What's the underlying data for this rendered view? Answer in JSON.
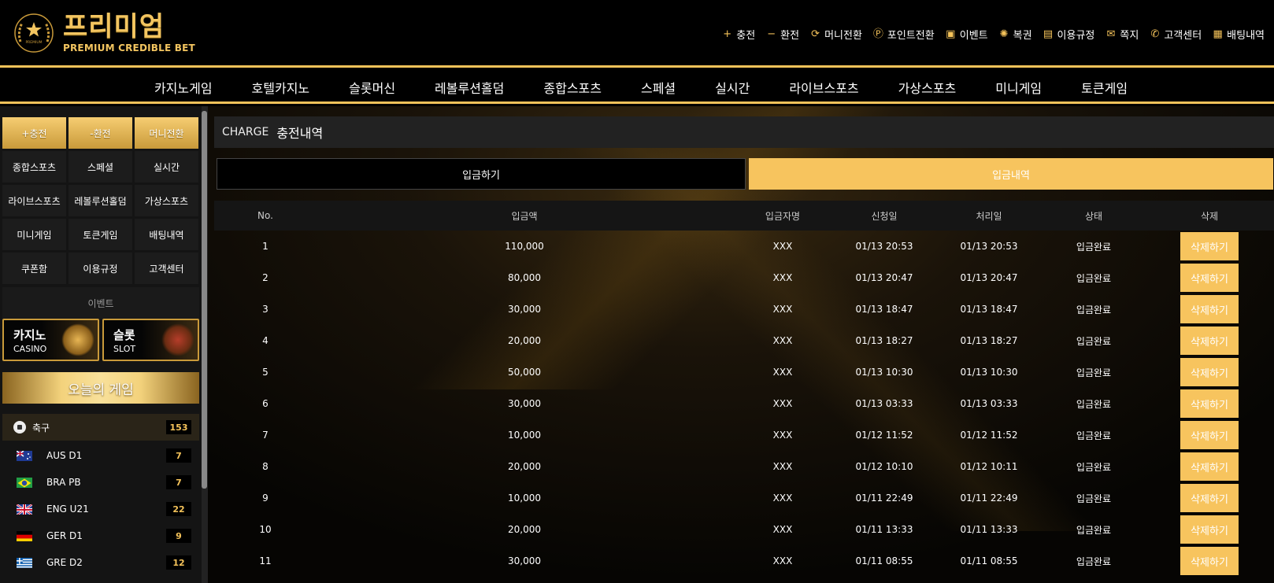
{
  "logo": {
    "title": "프리미엄",
    "subtitle": "PREMIUM CREDIBLE BET",
    "emblem_text": "PREMIUM"
  },
  "top_links": [
    {
      "icon": "plus-icon",
      "glyph": "+",
      "label": "충전"
    },
    {
      "icon": "minus-icon",
      "glyph": "−",
      "label": "환전"
    },
    {
      "icon": "refresh-icon",
      "glyph": "⟳",
      "label": "머니전환"
    },
    {
      "icon": "point-icon",
      "glyph": "Ⓟ",
      "label": "포인트전환"
    },
    {
      "icon": "gift-icon",
      "glyph": "▣",
      "label": "이벤트"
    },
    {
      "icon": "lottery-icon",
      "glyph": "✺",
      "label": "복권"
    },
    {
      "icon": "document-icon",
      "glyph": "▤",
      "label": "이용규정"
    },
    {
      "icon": "envelope-icon",
      "glyph": "✉",
      "label": "쪽지"
    },
    {
      "icon": "phone-icon",
      "glyph": "✆",
      "label": "고객센터"
    },
    {
      "icon": "betting-icon",
      "glyph": "▦",
      "label": "배팅내역"
    }
  ],
  "main_nav": [
    "카지노게임",
    "호텔카지노",
    "슬롯머신",
    "레볼루션홀덤",
    "종합스포츠",
    "스페셜",
    "실시간",
    "라이브스포츠",
    "가상스포츠",
    "미니게임",
    "토큰게임"
  ],
  "sidebar": {
    "buttons": [
      {
        "label": "+충전",
        "gold": true
      },
      {
        "label": "-환전",
        "gold": true
      },
      {
        "label": "머니전환",
        "gold": true
      },
      {
        "label": "종합스포츠"
      },
      {
        "label": "스페셜"
      },
      {
        "label": "실시간"
      },
      {
        "label": "라이브스포츠"
      },
      {
        "label": "레볼루션홀덤"
      },
      {
        "label": "가상스포츠"
      },
      {
        "label": "미니게임"
      },
      {
        "label": "토큰게임"
      },
      {
        "label": "배팅내역"
      },
      {
        "label": "쿠폰함"
      },
      {
        "label": "이용규정"
      },
      {
        "label": "고객센터"
      }
    ],
    "event_label": "이벤트",
    "banners": [
      {
        "title": "카지노",
        "sub": "CASINO"
      },
      {
        "title": "슬롯",
        "sub": "SLOT"
      }
    ],
    "today_title": "오늘의 게임",
    "sport": {
      "name": "축구",
      "count": "153"
    },
    "leagues": [
      {
        "name": "AUS D1",
        "count": "7",
        "flag": "au"
      },
      {
        "name": "BRA PB",
        "count": "7",
        "flag": "br"
      },
      {
        "name": "ENG U21",
        "count": "22",
        "flag": "gb"
      },
      {
        "name": "GER D1",
        "count": "9",
        "flag": "de"
      },
      {
        "name": "GRE D2",
        "count": "12",
        "flag": "gr"
      }
    ]
  },
  "content": {
    "title_en": "CHARGE",
    "title_ko": "충전내역",
    "tabs": [
      "입금하기",
      "입금내역"
    ],
    "columns": [
      "No.",
      "입금액",
      "입금자명",
      "신청일",
      "처리일",
      "상태",
      "삭제"
    ],
    "rows": [
      {
        "no": "1",
        "amount": "110,000",
        "name": "XXX",
        "req": "01/13 20:53",
        "proc": "01/13 20:53",
        "status": "입금완료",
        "btn": "삭제하기"
      },
      {
        "no": "2",
        "amount": "80,000",
        "name": "XXX",
        "req": "01/13 20:47",
        "proc": "01/13 20:47",
        "status": "입금완료",
        "btn": "삭제하기"
      },
      {
        "no": "3",
        "amount": "30,000",
        "name": "XXX",
        "req": "01/13 18:47",
        "proc": "01/13 18:47",
        "status": "입금완료",
        "btn": "삭제하기"
      },
      {
        "no": "4",
        "amount": "20,000",
        "name": "XXX",
        "req": "01/13 18:27",
        "proc": "01/13 18:27",
        "status": "입금완료",
        "btn": "삭제하기"
      },
      {
        "no": "5",
        "amount": "50,000",
        "name": "XXX",
        "req": "01/13 10:30",
        "proc": "01/13 10:30",
        "status": "입금완료",
        "btn": "삭제하기"
      },
      {
        "no": "6",
        "amount": "30,000",
        "name": "XXX",
        "req": "01/13 03:33",
        "proc": "01/13 03:33",
        "status": "입금완료",
        "btn": "삭제하기"
      },
      {
        "no": "7",
        "amount": "10,000",
        "name": "XXX",
        "req": "01/12 11:52",
        "proc": "01/12 11:52",
        "status": "입금완료",
        "btn": "삭제하기"
      },
      {
        "no": "8",
        "amount": "20,000",
        "name": "XXX",
        "req": "01/12 10:10",
        "proc": "01/12 10:11",
        "status": "입금완료",
        "btn": "삭제하기"
      },
      {
        "no": "9",
        "amount": "10,000",
        "name": "XXX",
        "req": "01/11 22:49",
        "proc": "01/11 22:49",
        "status": "입금완료",
        "btn": "삭제하기"
      },
      {
        "no": "10",
        "amount": "20,000",
        "name": "XXX",
        "req": "01/11 13:33",
        "proc": "01/11 13:33",
        "status": "입금완료",
        "btn": "삭제하기"
      },
      {
        "no": "11",
        "amount": "30,000",
        "name": "XXX",
        "req": "01/11 08:55",
        "proc": "01/11 08:55",
        "status": "입금완료",
        "btn": "삭제하기"
      }
    ]
  },
  "colors": {
    "gold": "#f7c45e",
    "gold_dark": "#c99a3a",
    "bg": "#000000"
  }
}
